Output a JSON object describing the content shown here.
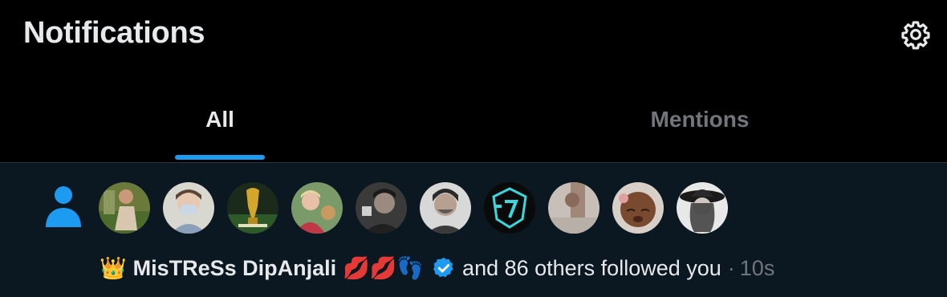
{
  "header": {
    "title": "Notifications",
    "settings_icon": "gear-icon"
  },
  "tabs": [
    {
      "label": "All",
      "active": true
    },
    {
      "label": "Mentions",
      "active": false
    }
  ],
  "colors": {
    "accent": "#1d9bf0",
    "background": "#000000",
    "notification_bg": "#0b1721",
    "text_primary": "#e7e9ea",
    "text_secondary": "#71767b"
  },
  "notification": {
    "type_icon": "person-icon",
    "avatar_count": 10,
    "user": {
      "name": "MisTReSs DipAnjali",
      "prefix_emoji": "👑",
      "suffix_emojis": [
        "💋",
        "💋",
        "👣"
      ],
      "verified": true
    },
    "text": "and 86 others followed you",
    "separator": "·",
    "time": "10s"
  }
}
